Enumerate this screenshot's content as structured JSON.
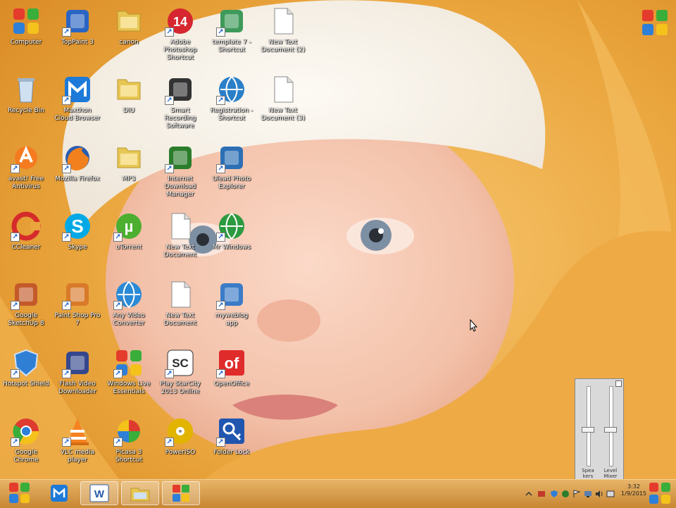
{
  "desktop": {
    "icons": [
      {
        "label": "Computer",
        "icon": "computer-icon",
        "color": "#3c6fd1"
      },
      {
        "label": "Recycle Bin",
        "icon": "recycle-bin-icon",
        "color": "#9fb6cc"
      },
      {
        "label": "avast! Free Antivirus",
        "icon": "avast-icon",
        "color": "#f47b20"
      },
      {
        "label": "CCleaner",
        "icon": "ccleaner-icon",
        "color": "#d62b2b"
      },
      {
        "label": "Google SketchUp 8",
        "icon": "sketchup-icon",
        "color": "#c45a2a"
      },
      {
        "label": "Hotspot Shield",
        "icon": "hotspot-shield-icon",
        "color": "#2f7fd4"
      },
      {
        "label": "Google Chrome",
        "icon": "chrome-icon",
        "color": "#de3b2f"
      },
      {
        "label": "TopPaint 3",
        "icon": "paint-icon",
        "color": "#2b65c4"
      },
      {
        "label": "Maxthon Cloud Browser",
        "icon": "maxthon-icon",
        "color": "#1d7ad8"
      },
      {
        "label": "Mozilla Firefox",
        "icon": "firefox-icon",
        "color": "#f2811d"
      },
      {
        "label": "Skype",
        "icon": "skype-icon",
        "color": "#00a9e6"
      },
      {
        "label": "Paint Shop Pro 7",
        "icon": "paint-shop-icon",
        "color": "#d97a2a"
      },
      {
        "label": "Flash Video Downloader",
        "icon": "video-downloader-icon",
        "color": "#35478c"
      },
      {
        "label": "VLC media player",
        "icon": "vlc-icon",
        "color": "#f58220"
      },
      {
        "label": "canon",
        "icon": "folder-icon",
        "color": "#e8c654"
      },
      {
        "label": "DIU",
        "icon": "folder-icon",
        "color": "#e8c654"
      },
      {
        "label": "MP3",
        "icon": "folder-icon",
        "color": "#e8c654"
      },
      {
        "label": "uTorrent",
        "icon": "utorrent-icon",
        "color": "#4caf2f"
      },
      {
        "label": "Any Video Converter",
        "icon": "video-converter-icon",
        "color": "#2a8ad6"
      },
      {
        "label": "Windows Live Essentials",
        "icon": "windows-icon",
        "color": "#2b8a3e"
      },
      {
        "label": "Picasa 3 Shortcut",
        "icon": "picasa-icon",
        "color": "#d93a8a"
      },
      {
        "label": "Adobe Photoshop Shortcut",
        "icon": "app-14-icon",
        "color": "#d6262f"
      },
      {
        "label": "Smart Recording Software",
        "icon": "camera-icon",
        "color": "#333333"
      },
      {
        "label": "Internet Download Manager",
        "icon": "idm-icon",
        "color": "#2b7c2b"
      },
      {
        "label": "New Text Document",
        "icon": "text-document-icon",
        "color": "#ffffff"
      },
      {
        "label": "New Text Document",
        "icon": "text-document-icon",
        "color": "#ffffff"
      },
      {
        "label": "Play StarCity 2013 Online",
        "icon": "sc-icon",
        "color": "#333333"
      },
      {
        "label": "PowerISO",
        "icon": "poweriso-icon",
        "color": "#e2b400"
      },
      {
        "label": "template 7 - Shortcut",
        "icon": "template-icon",
        "color": "#3e9a5a"
      },
      {
        "label": "Registration - Shortcut",
        "icon": "registration-icon",
        "color": "#2a7fc8"
      },
      {
        "label": "Ulead Photo Explorer",
        "icon": "photo-explorer-icon",
        "color": "#2c6fb5"
      },
      {
        "label": "Mr Windows",
        "icon": "globe-icon",
        "color": "#2c9a3e"
      },
      {
        "label": "myweblog app",
        "icon": "network-icon",
        "color": "#3b7bc7"
      },
      {
        "label": "OpenOffice",
        "icon": "openoffice-icon",
        "color": "#e02b2b"
      },
      {
        "label": "Folder Lock",
        "icon": "folder-lock-icon",
        "color": "#2056b0"
      },
      {
        "label": "New Text Document (2)",
        "icon": "text-document-icon",
        "color": "#ffffff"
      },
      {
        "label": "New Text Document (3)",
        "icon": "text-document-icon",
        "color": "#ffffff"
      }
    ]
  },
  "mixer": {
    "device_label": "Spea kers",
    "app_label": "Level Mixer",
    "device_level": 0.45,
    "app_level": 0.45
  },
  "taskbar": {
    "start_icon": "windows-flag-icon",
    "pinned": [
      {
        "name": "maxthon",
        "icon": "maxthon-icon"
      },
      {
        "name": "word",
        "icon": "word-icon"
      },
      {
        "name": "explorer",
        "icon": "explorer-icon"
      },
      {
        "name": "flag-app",
        "icon": "windows-flag-icon"
      }
    ],
    "clock_time": "3:32",
    "clock_date": "1/9/2015",
    "colors": {
      "bar": "#d8953b",
      "accent": "#f1cf93"
    }
  }
}
